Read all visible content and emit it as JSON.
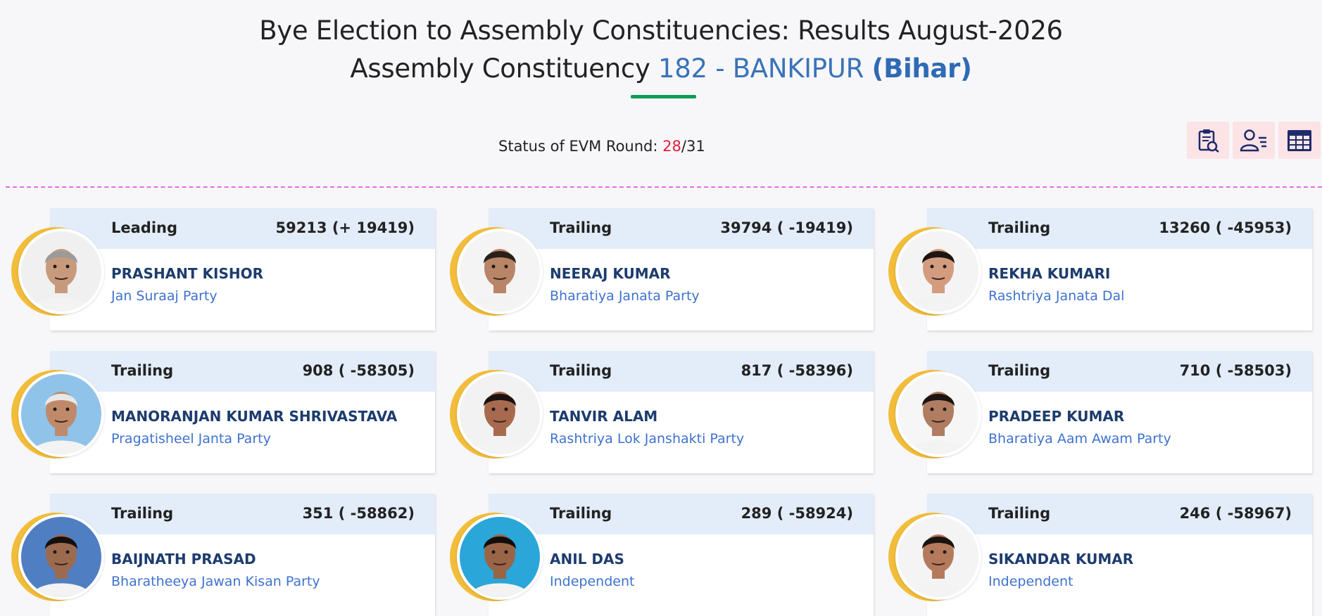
{
  "header": {
    "title_line1": "Bye Election to Assembly Constituencies: Results August-2026",
    "title_prefix": "Assembly Constituency",
    "ac_number": "182 - BANKIPUR",
    "state": "(Bihar)"
  },
  "round": {
    "label": "Status of EVM Round:",
    "current": "28",
    "separator": "/",
    "total": "31"
  },
  "toolbar": {
    "buttons": [
      {
        "icon": "report-clipboard-icon"
      },
      {
        "icon": "candidate-list-icon"
      },
      {
        "icon": "table-grid-icon"
      }
    ]
  },
  "colors": {
    "accent_blue": "#3a73b8",
    "underline_green": "#0d9b55",
    "round_red": "#e0203b",
    "card_header": "#e3ecf9",
    "ring_gold": "#f2bd3a",
    "divider_pink": "#e66be0"
  },
  "candidates": [
    {
      "status": "Leading",
      "votes": "59213 (+ 19419)",
      "name": "PRASHANT KISHOR",
      "party": "Jan Suraaj Party",
      "photo_bg": "#f0f0f0",
      "skin": "#c89a7c",
      "hair": "#9a9a9a"
    },
    {
      "status": "Trailing",
      "votes": "39794 ( -19419)",
      "name": "NEERAJ KUMAR",
      "party": "Bharatiya Janata Party",
      "photo_bg": "#f4f4f4",
      "skin": "#b98567",
      "hair": "#2a1f1a"
    },
    {
      "status": "Trailing",
      "votes": "13260 ( -45953)",
      "name": "REKHA KUMARI",
      "party": "Rashtriya Janata Dal",
      "photo_bg": "#f4f4f4",
      "skin": "#d49c7f",
      "hair": "#1d1512"
    },
    {
      "status": "Trailing",
      "votes": "908 ( -58305)",
      "name": "MANORANJAN KUMAR SHRIVASTAVA",
      "party": "Pragatisheel Janta Party",
      "photo_bg": "#8fc3ea",
      "skin": "#c08a6a",
      "hair": "#e8e8e8"
    },
    {
      "status": "Trailing",
      "votes": "817 ( -58396)",
      "name": "TANVIR ALAM",
      "party": "Rashtriya Lok Janshakti Party",
      "photo_bg": "#f2f2f2",
      "skin": "#a86a4e",
      "hair": "#1a1210"
    },
    {
      "status": "Trailing",
      "votes": "710 ( -58503)",
      "name": "PRADEEP KUMAR",
      "party": "Bharatiya Aam Awam Party",
      "photo_bg": "#f6f6f6",
      "skin": "#b07c62",
      "hair": "#1c1411"
    },
    {
      "status": "Trailing",
      "votes": "351 ( -58862)",
      "name": "BAIJNATH PRASAD",
      "party": "Bharatheeya Jawan Kisan Party",
      "photo_bg": "#4f7fc2",
      "skin": "#9c6a4f",
      "hair": "#151010"
    },
    {
      "status": "Trailing",
      "votes": "289 ( -58924)",
      "name": "ANIL DAS",
      "party": "Independent",
      "photo_bg": "#2aa6d9",
      "skin": "#9a6447",
      "hair": "#120d0b"
    },
    {
      "status": "Trailing",
      "votes": "246 ( -58967)",
      "name": "SIKANDAR KUMAR",
      "party": "Independent",
      "photo_bg": "#f4f4f4",
      "skin": "#b57a5c",
      "hair": "#1a1310"
    }
  ]
}
